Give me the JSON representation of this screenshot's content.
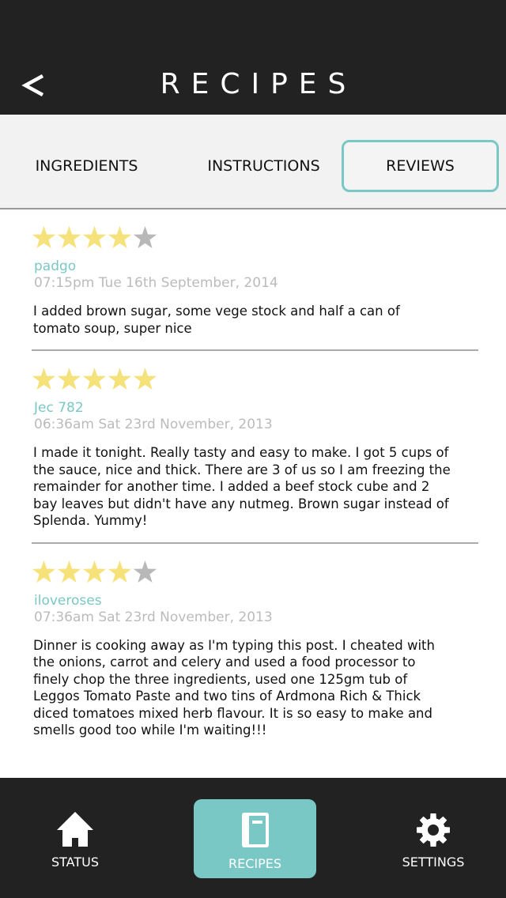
{
  "header": {
    "title": "RECIPES",
    "back_icon": "back-arrow-icon"
  },
  "tabs": [
    {
      "label": "INGREDIENTS",
      "active": false
    },
    {
      "label": "INSTRUCTIONS",
      "active": false
    },
    {
      "label": "REVIEWS",
      "active": true
    }
  ],
  "colors": {
    "accent": "#7ac8c5",
    "star_filled": "#f5e27a",
    "star_empty": "#b8b8b8",
    "bar": "#222222"
  },
  "reviews": [
    {
      "rating": 4,
      "max_rating": 5,
      "user": "padgo",
      "date": "07:15pm Tue 16th September, 2014",
      "text": "I added brown sugar, some vege stock and half a can of tomato soup, super nice"
    },
    {
      "rating": 5,
      "max_rating": 5,
      "user": "Jec 782",
      "date": "06:36am Sat 23rd November, 2013",
      "text": "I made it tonight. Really tasty and easy to make. I got 5 cups of the sauce, nice and thick. There are 3 of us so I am freezing the remainder for another time. I added a beef stock cube and 2 bay leaves but didn't have any nutmeg. Brown sugar instead of Splenda. Yummy!"
    },
    {
      "rating": 4,
      "max_rating": 5,
      "user": "iloveroses",
      "date": "07:36am Sat 23rd November, 2013",
      "text": "Dinner is cooking away as I'm typing this post. I cheated with the onions, carrot and celery and used a food processor to finely chop the three ingredients, used one 125gm tub of Leggos Tomato Paste and two tins of Ardmona Rich & Thick diced tomatoes mixed herb flavour. It is so easy to make and smells good too while I'm waiting!!!"
    }
  ],
  "nav": [
    {
      "label": "STATUS",
      "icon": "home-icon",
      "active": false
    },
    {
      "label": "RECIPES",
      "icon": "book-icon",
      "active": true
    },
    {
      "label": "SETTINGS",
      "icon": "gear-icon",
      "active": false
    }
  ]
}
